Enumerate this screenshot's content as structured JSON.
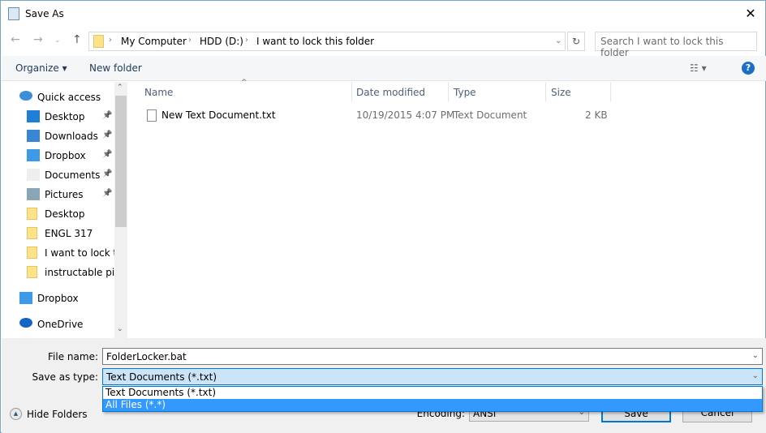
{
  "window": {
    "title": "Save As",
    "close": "✕"
  },
  "address": {
    "crumbs": [
      "My Computer",
      "HDD (D:)",
      "I want to lock this folder"
    ],
    "search_placeholder": "Search I want to lock this folder"
  },
  "toolbar": {
    "organize": "Organize ▾",
    "new_folder": "New folder",
    "help": "?"
  },
  "nav": {
    "items": [
      {
        "label": "Quick access",
        "icon": "star-icon"
      },
      {
        "label": "Desktop",
        "icon": "desktop-icon",
        "pinned": true
      },
      {
        "label": "Downloads",
        "icon": "download-icon",
        "pinned": true
      },
      {
        "label": "Dropbox",
        "icon": "dropbox-icon",
        "pinned": true
      },
      {
        "label": "Documents",
        "icon": "documents-icon",
        "pinned": true
      },
      {
        "label": "Pictures",
        "icon": "pictures-icon",
        "pinned": true
      },
      {
        "label": "Desktop",
        "icon": "folder-icon"
      },
      {
        "label": "ENGL 317",
        "icon": "folder-icon"
      },
      {
        "label": "I want to lock this folder",
        "icon": "folder-icon"
      },
      {
        "label": "instructable pics",
        "icon": "folder-icon"
      },
      {
        "label": "Dropbox",
        "icon": "dropbox-icon"
      },
      {
        "label": "OneDrive",
        "icon": "onedrive-icon"
      }
    ]
  },
  "columns": [
    "Name",
    "Date modified",
    "Type",
    "Size"
  ],
  "files": [
    {
      "name": "New Text Document.txt",
      "date": "10/19/2015 4:07 PM",
      "type": "Text Document",
      "size": "2 KB"
    }
  ],
  "form": {
    "file_name_label": "File name:",
    "file_name": "FolderLocker.bat",
    "type_label": "Save as type:",
    "type_value": "Text Documents (*.txt)",
    "type_options": [
      "Text Documents (*.txt)",
      "All Files  (*.*)"
    ],
    "encoding_label": "Encoding:",
    "encoding": "ANSI",
    "save": "Save",
    "cancel": "Cancel",
    "hide_folders": "Hide Folders"
  },
  "colors": {
    "accent": "#0078d7",
    "selected_option": "#3399ff",
    "select_bg": "#cce4f7"
  }
}
